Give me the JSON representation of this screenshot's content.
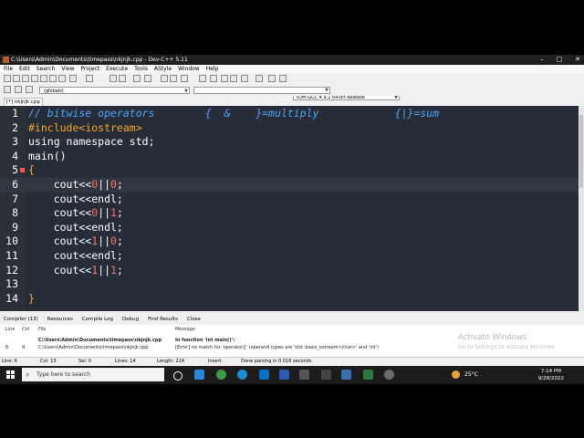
{
  "window": {
    "title": "C:\\Users\\Admin\\Documents\\timepass\\nkjnjk.cpp - Dev-C++ 5.11",
    "controls": [
      "–",
      "□",
      "✕"
    ]
  },
  "menu": [
    "File",
    "Edit",
    "Search",
    "View",
    "Project",
    "Execute",
    "Tools",
    "AStyle",
    "Window",
    "Help"
  ],
  "toolbar": {
    "compiler": "TDM-GCC 4.9.2 64-bit Release",
    "scope": "(globals)"
  },
  "file_tab": "[*] nkjnjk.cpp",
  "editor": {
    "lines": [
      {
        "n": "1",
        "segments": [
          {
            "t": "// bitwise operators        {  &    }=multiply            {|}=sum",
            "c": "cmt"
          }
        ]
      },
      {
        "n": "2",
        "segments": [
          {
            "t": "#include<iostream>",
            "c": "dir"
          }
        ]
      },
      {
        "n": "3",
        "segments": [
          {
            "t": "using namespace std;",
            "c": ""
          }
        ]
      },
      {
        "n": "4",
        "segments": [
          {
            "t": "main()",
            "c": ""
          }
        ]
      },
      {
        "n": "5",
        "fold": true,
        "segments": [
          {
            "t": "{",
            "c": "dir"
          }
        ]
      },
      {
        "n": "6",
        "current": true,
        "segments": [
          {
            "t": "    cout<<",
            "c": ""
          },
          {
            "t": "0",
            "c": "num"
          },
          {
            "t": "||",
            "c": ""
          },
          {
            "t": "0",
            "c": "num"
          },
          {
            "t": ";",
            "c": ""
          }
        ]
      },
      {
        "n": "7",
        "segments": [
          {
            "t": "    cout<<endl;",
            "c": ""
          }
        ]
      },
      {
        "n": "8",
        "segments": [
          {
            "t": "    cout<<",
            "c": ""
          },
          {
            "t": "0",
            "c": "num"
          },
          {
            "t": "||",
            "c": ""
          },
          {
            "t": "1",
            "c": "num"
          },
          {
            "t": ";",
            "c": ""
          }
        ]
      },
      {
        "n": "9",
        "segments": [
          {
            "t": "    cout<<endl;",
            "c": ""
          }
        ]
      },
      {
        "n": "10",
        "segments": [
          {
            "t": "    cout<<",
            "c": ""
          },
          {
            "t": "1",
            "c": "num"
          },
          {
            "t": "||",
            "c": ""
          },
          {
            "t": "0",
            "c": "num"
          },
          {
            "t": ";",
            "c": ""
          }
        ]
      },
      {
        "n": "11",
        "segments": [
          {
            "t": "    cout<<endl;",
            "c": ""
          }
        ]
      },
      {
        "n": "12",
        "segments": [
          {
            "t": "    cout<<",
            "c": ""
          },
          {
            "t": "1",
            "c": "num"
          },
          {
            "t": "||",
            "c": ""
          },
          {
            "t": "1",
            "c": "num"
          },
          {
            "t": ";",
            "c": ""
          }
        ]
      },
      {
        "n": "13",
        "segments": [
          {
            "t": "",
            "c": ""
          }
        ]
      },
      {
        "n": "14",
        "segments": [
          {
            "t": "}",
            "c": "dir"
          }
        ]
      }
    ]
  },
  "bottom_tabs": [
    "Compiler (13)",
    "Resources",
    "Compile Log",
    "Debug",
    "Find Results",
    "Close"
  ],
  "messages": {
    "headers": {
      "line": "Line",
      "col": "Col",
      "file": "File",
      "message": "Message"
    },
    "rows": [
      {
        "line": "",
        "col": "",
        "file": "C:\\Users\\Admin\\Documents\\timepass\\nkjnjk.cpp",
        "message": "In function 'int main()':"
      },
      {
        "line": "6",
        "col": "9",
        "file": "C:\\Users\\Admin\\Documents\\timepass\\nkjnjk.cpp",
        "message": "[Error] no match for 'operator||' (operand types are 'std::basic_ostream<char>' and 'int')"
      }
    ]
  },
  "watermark": {
    "title": "Activate Windows",
    "subtitle": "Go to Settings to activate Windows."
  },
  "status": {
    "line": "Line:   6",
    "col": "Col:   13",
    "sel": "Sel:   0",
    "lines": "Lines:   14",
    "length": "Length:   224",
    "mode": "Insert",
    "message": "Done parsing in 0.016 seconds"
  },
  "taskbar": {
    "search_placeholder": "Type here to search",
    "temperature": "25°C",
    "time": "7:14 PM",
    "date": "9/28/2022"
  },
  "colors": {
    "editor_bg": "#262d38",
    "comment": "#4fa3f7",
    "directive": "#f5a623",
    "number": "#ff6f6f"
  }
}
